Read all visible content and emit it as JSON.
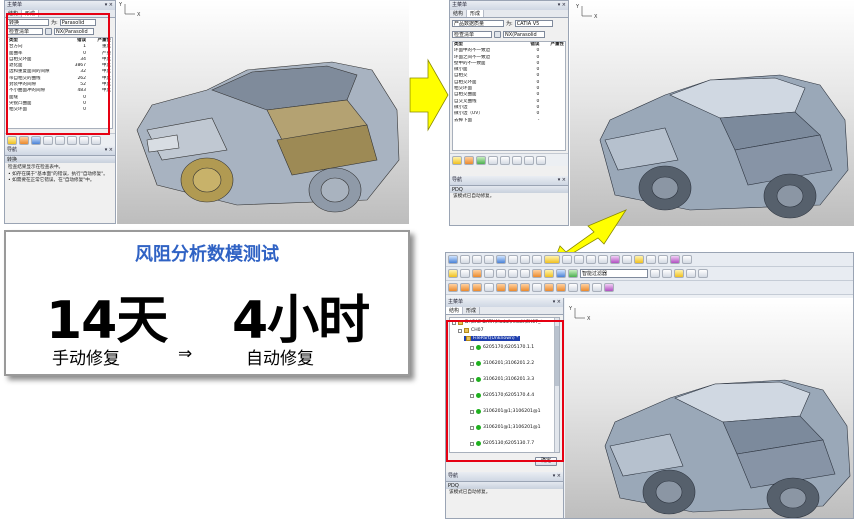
{
  "panel1": {
    "title": "主菜单",
    "tabs": [
      "结构",
      "形成"
    ],
    "combo1": "转换",
    "to_label": "为:",
    "to_value": "Parasolid",
    "combo2": "检查清单",
    "combo3": "NX(Parasolid",
    "columns": [
      "类型",
      "错误",
      "严重性"
    ],
    "rows": [
      [
        "合方向",
        "1",
        "重度"
      ],
      [
        "面曲率",
        "0",
        "严重"
      ],
      [
        "自相交环面",
        "34",
        "中度"
      ],
      [
        "退化面",
        "3867",
        "中度"
      ],
      [
        "边和重复面间的间隙",
        "32",
        "中度"
      ],
      [
        "带自相交的曲线",
        "262",
        "中度"
      ],
      [
        "封装中的间隙",
        "52",
        "中度"
      ],
      [
        "不小曲面冲的间隙",
        "483",
        "中度"
      ],
      [
        "面缝",
        "0",
        ""
      ],
      [
        "尖锐凸曲面",
        "0",
        ""
      ],
      [
        "相交环面",
        "0",
        ""
      ]
    ],
    "nav_title": "导航",
    "nav_section": "转换",
    "nav_lines": [
      "检查结果显示在检查表中。",
      "• 如存在属于\"基本面\"的错误，执行\"自动修复\"。",
      "• 如需要在正常它错误，在\"自动修复\"中。"
    ]
  },
  "panel2": {
    "title": "主菜单",
    "tabs": [
      "结构",
      "形成"
    ],
    "combo1": "产品数据质量",
    "to_label": "为:",
    "to_value": "CATIA V5",
    "combo2": "检查清单",
    "combo3": "NX(Parasolid",
    "columns": [
      "类型",
      "错误",
      "严重性"
    ],
    "rows": [
      [
        "环面中的不一致边",
        "0",
        ""
      ],
      [
        "环面之间不一致边",
        "0",
        ""
      ],
      [
        "壁中的不一致面",
        "0",
        ""
      ],
      [
        "微小面",
        "0",
        ""
      ],
      [
        "自相交",
        "0",
        ""
      ],
      [
        "自相交环面",
        "0",
        ""
      ],
      [
        "相交环面",
        "0",
        ""
      ],
      [
        "自相交曲面",
        "0",
        ""
      ],
      [
        "自交叉曲线",
        "0",
        ""
      ],
      [
        "微小边",
        "0",
        ""
      ],
      [
        "微小边（UV）",
        "0",
        ""
      ],
      [
        "去掉下面",
        "-",
        ""
      ]
    ],
    "nav_title": "导航",
    "pdq_section": "PDQ",
    "pdq_text": "该模式已自动修复。"
  },
  "panel3": {
    "title": "主菜单",
    "tabs": [
      "结构",
      "形成"
    ],
    "combo_selected": "智能过滤器",
    "tree": [
      "D:\\CAE DATA\\Modal\\result\\CH07_*",
      "CH07",
      "FilePart(Unknown) *",
      "6205170;6205170.1.1",
      "3106201;3106201.2.2",
      "3106201;3106201.3.3",
      "6205170;6205170.4.4",
      "3106201@1;3106201@1",
      "3106201@1;3106201@1",
      "6205130;6205130.7.7"
    ],
    "button": "确定",
    "nav_title": "导航",
    "pdq_section": "PDQ",
    "pdq_text": "该模式已自动修复。"
  },
  "summary": {
    "title": "风阻分析数模测试",
    "manual_value": "14天",
    "auto_value": "4小时",
    "manual_label": "手动修复",
    "arrow": "⇒",
    "auto_label": "自动修复"
  },
  "colors": {
    "highlight": "#e60012",
    "arrow_fill": "#ffff00",
    "title_blue": "#2f62c4"
  }
}
